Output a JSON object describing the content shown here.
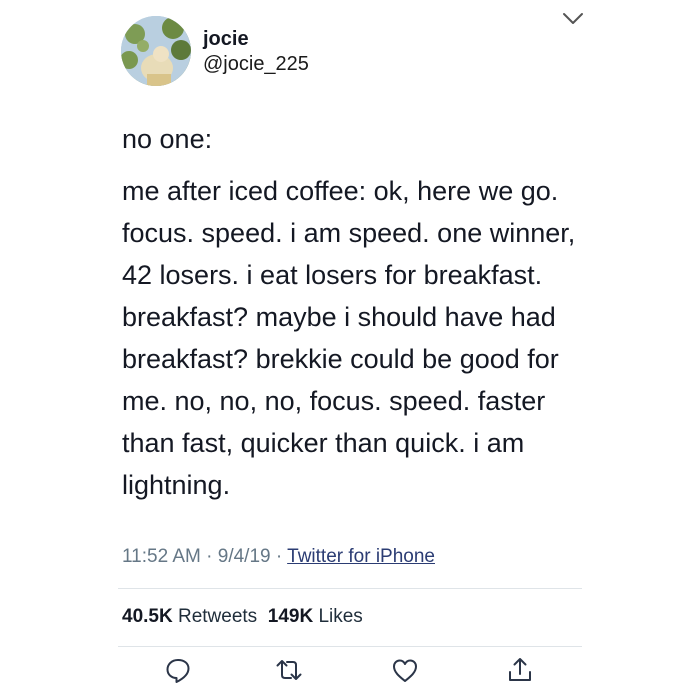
{
  "user": {
    "name": "jocie",
    "handle": "@jocie_225"
  },
  "tweet": {
    "intro": "no one:",
    "text": "me after iced coffee: ok, here we go. focus. speed. i am speed. one winner, 42 losers. i eat losers for breakfast. breakfast? maybe i should have had breakfast? brekkie could be good for me. no, no, no, focus. speed. faster than fast, quicker than quick. i am lightning.",
    "time": "11:52 AM",
    "date": "9/4/19",
    "separator": "·",
    "source": "Twitter for iPhone"
  },
  "stats": {
    "retweets_count": "40.5K",
    "retweets_label": "Retweets",
    "likes_count": "149K",
    "likes_label": "Likes"
  },
  "icons": {
    "menu": "chevron-down-icon",
    "reply": "reply-icon",
    "retweet": "retweet-icon",
    "like": "heart-icon",
    "share": "share-icon"
  },
  "colors": {
    "icon": "#657786",
    "link": "#2b3c73",
    "divider": "#dfe4e8"
  }
}
